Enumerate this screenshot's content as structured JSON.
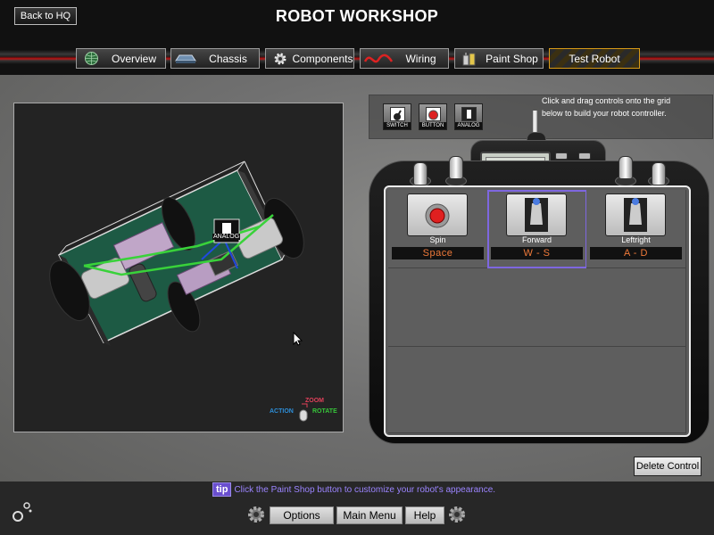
{
  "header": {
    "title": "ROBOT WORKSHOP",
    "back_label": "Back to HQ",
    "tabs": [
      {
        "label": "Overview",
        "icon": "globe-icon"
      },
      {
        "label": "Chassis",
        "icon": "chassis-icon"
      },
      {
        "label": "Components",
        "icon": "gear-icon"
      },
      {
        "label": "Wiring",
        "icon": "wire-icon"
      },
      {
        "label": "Paint Shop",
        "icon": "paint-cans-icon"
      },
      {
        "label": "Test Robot",
        "icon": "",
        "active": true
      }
    ]
  },
  "viewport": {
    "component_label": "ANALOG",
    "legend": {
      "zoom": "ZOOM",
      "action": "ACTION",
      "rotate": "ROTATE"
    }
  },
  "toolbox": {
    "instructions": "Click and drag controls onto the grid below to build your robot controller.",
    "tools": [
      {
        "label": "SWITCH",
        "icon": "switch-icon"
      },
      {
        "label": "BUTTON",
        "icon": "button-icon"
      },
      {
        "label": "ANALOG",
        "icon": "analog-icon"
      }
    ]
  },
  "controller": {
    "cells": [
      {
        "name": "Spin",
        "key": "Space",
        "type": "button"
      },
      {
        "name": "Forward",
        "key": "W - S",
        "type": "analog",
        "selected": true
      },
      {
        "name": "Leftright",
        "key": "A - D",
        "type": "analog"
      }
    ],
    "delete_label": "Delete Control"
  },
  "footer": {
    "tip_badge": "tip",
    "tip_text": "Click the Paint Shop button to customize your robot's appearance.",
    "options_label": "Options",
    "main_menu_label": "Main Menu",
    "help_label": "Help"
  },
  "colors": {
    "accent": "#6a4fcf",
    "key_text": "#f07a3a",
    "active_tab": "#d79a18"
  }
}
